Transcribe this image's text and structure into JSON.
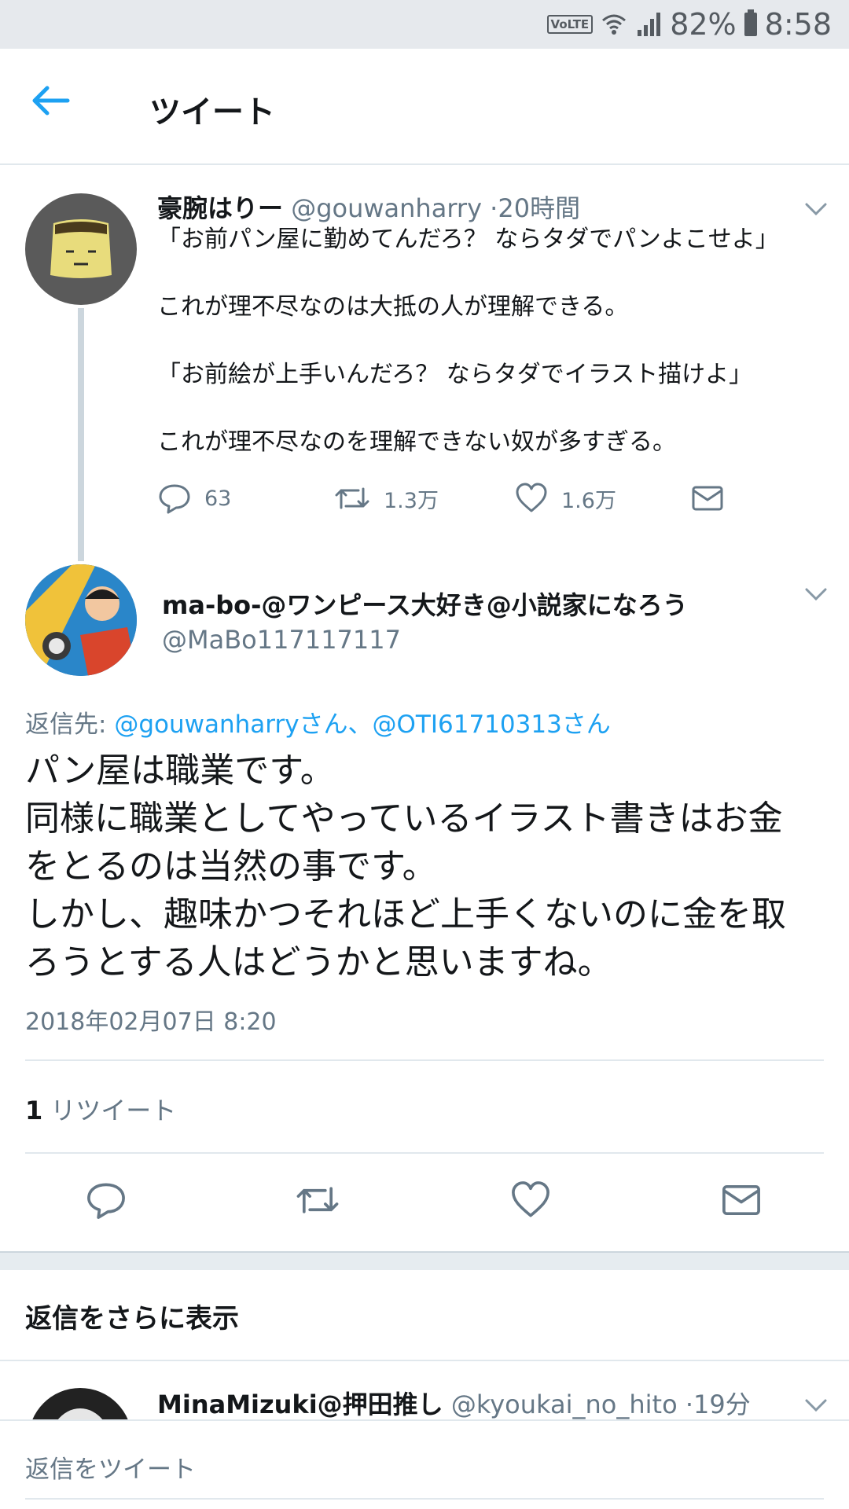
{
  "status_bar": {
    "volte": "VoLTE",
    "battery": "82%",
    "time": "8:58",
    "icons": [
      "wifi-icon",
      "signal-icon",
      "battery-icon"
    ]
  },
  "header": {
    "back_icon": "back-arrow-icon",
    "title": "ツイート"
  },
  "tweet1": {
    "name": "豪腕はりー",
    "handle": "@gouwanharry",
    "time": "20時間",
    "body": "「お前パン屋に勤めてんだろ？ ならタダでパンよこせよ」\n\nこれが理不尽なのは大抵の人が理解できる。\n\n「お前絵が上手いんだろ？ ならタダでイラスト描けよ」\n\nこれが理不尽なのを理解できない奴が多すぎる。",
    "replies": "63",
    "retweets": "1.3万",
    "likes": "1.6万"
  },
  "tweet2": {
    "name": "ma-bo-@ワンピース大好き@小説家になろう",
    "handle": "@MaBo117117117",
    "reply_prefix": "返信先: ",
    "reply_targets": "@gouwanharryさん、@OTI61710313さん",
    "body": "パン屋は職業です。\n同様に職業としてやっているイラスト書きはお金\nをとるのは当然の事です。\nしかし、趣味かつそれほど上手くないのに金を取\nろうとする人はどうかと思いますね。",
    "date": "2018年02月07日 8:20",
    "retweet_count": "1",
    "retweet_label": "リツイート"
  },
  "more_replies": {
    "title": "返信をさらに表示"
  },
  "tweet3": {
    "name": "MinaMizuki@押田推し",
    "handle": "@kyoukai_no_hito",
    "time": "19分"
  },
  "reply_bar": {
    "placeholder": "返信をツイート"
  },
  "colors": {
    "accent": "#1da1f2",
    "text": "#14171a",
    "muted": "#657786",
    "divider": "#e1e8ed"
  }
}
